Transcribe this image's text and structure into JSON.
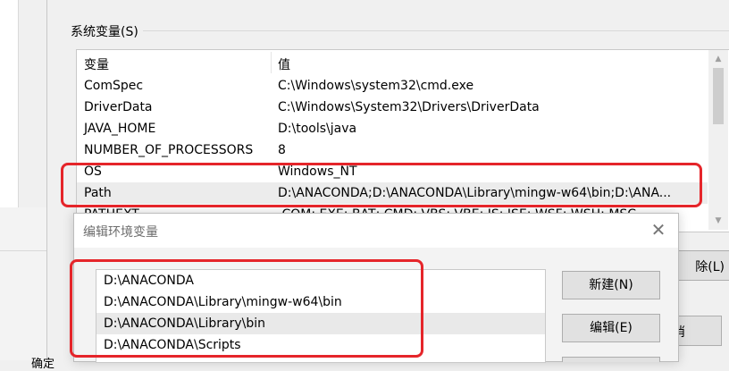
{
  "left_bottom_text": "确定",
  "system_variables": {
    "group_label": "系统变量(S)",
    "col_name": "变量",
    "col_value": "值",
    "rows": [
      {
        "name": "ComSpec",
        "value": "C:\\Windows\\system32\\cmd.exe"
      },
      {
        "name": "DriverData",
        "value": "C:\\Windows\\System32\\Drivers\\DriverData"
      },
      {
        "name": "JAVA_HOME",
        "value": "D:\\tools\\java"
      },
      {
        "name": "NUMBER_OF_PROCESSORS",
        "value": "8"
      },
      {
        "name": "OS",
        "value": "Windows_NT"
      },
      {
        "name": "Path",
        "value": "D:\\ANACONDA;D:\\ANACONDA\\Library\\mingw-w64\\bin;D:\\ANA..."
      },
      {
        "name": "PATHEXT",
        "value": ".COM;.EXE;.BAT;.CMD;.VBS;.VBE;.JS;.JSE;.WSF;.WSH;.MSC"
      }
    ],
    "selected_row": "Path"
  },
  "background_buttons": {
    "delete_label": "除(L)",
    "cancel_label": "消"
  },
  "edit_dialog": {
    "title": "编辑环境变量",
    "close_icon": "close-icon",
    "paths": [
      "D:\\ANACONDA",
      "D:\\ANACONDA\\Library\\mingw-w64\\bin",
      "D:\\ANACONDA\\Library\\bin",
      "D:\\ANACONDA\\Scripts"
    ],
    "selected_path": "D:\\ANACONDA\\Library\\bin",
    "new_button": "新建(N)",
    "edit_button": "编辑(E)"
  },
  "colors": {
    "highlight": "#e5252a",
    "selection": "#ececec",
    "button_bg": "#e1e1e1"
  }
}
